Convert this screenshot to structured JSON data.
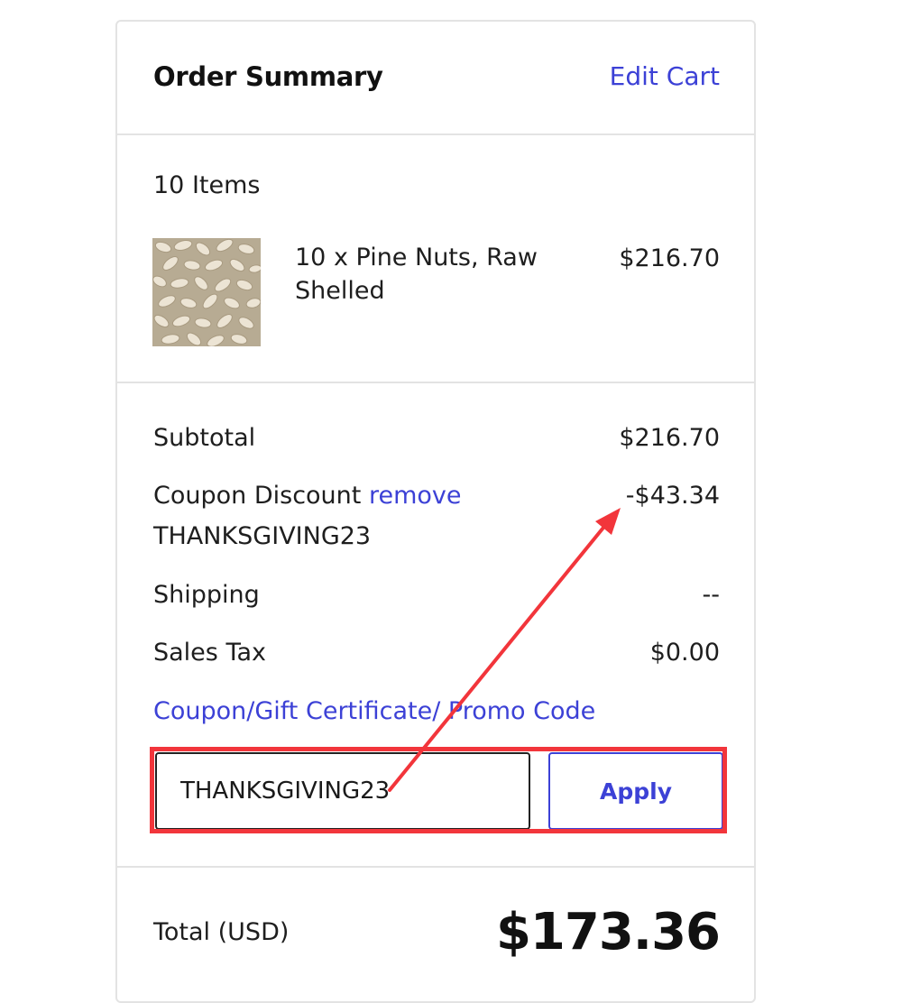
{
  "summary": {
    "title": "Order Summary",
    "edit_cart_label": "Edit Cart"
  },
  "cart": {
    "item_count_label": "10 Items",
    "items": [
      {
        "name": "10 x Pine Nuts, Raw Shelled",
        "price": "$216.70",
        "thumbnail": "pine-nuts-photo"
      }
    ]
  },
  "totals": {
    "subtotal_label": "Subtotal",
    "subtotal_value": "$216.70",
    "coupon_label": "Coupon Discount",
    "coupon_remove_label": "remove",
    "coupon_code": "THANKSGIVING23",
    "coupon_value": "-$43.34",
    "shipping_label": "Shipping",
    "shipping_value": "--",
    "tax_label": "Sales Tax",
    "tax_value": "$0.00"
  },
  "promo": {
    "link_label": "Coupon/Gift Certificate/ Promo Code",
    "input_value": "THANKSGIVING23",
    "apply_label": "Apply"
  },
  "total": {
    "label": "Total (USD)",
    "value": "$173.36"
  },
  "colors": {
    "link": "#3c41d6",
    "annotation": "#f2353b",
    "border": "#e3e3e3"
  }
}
